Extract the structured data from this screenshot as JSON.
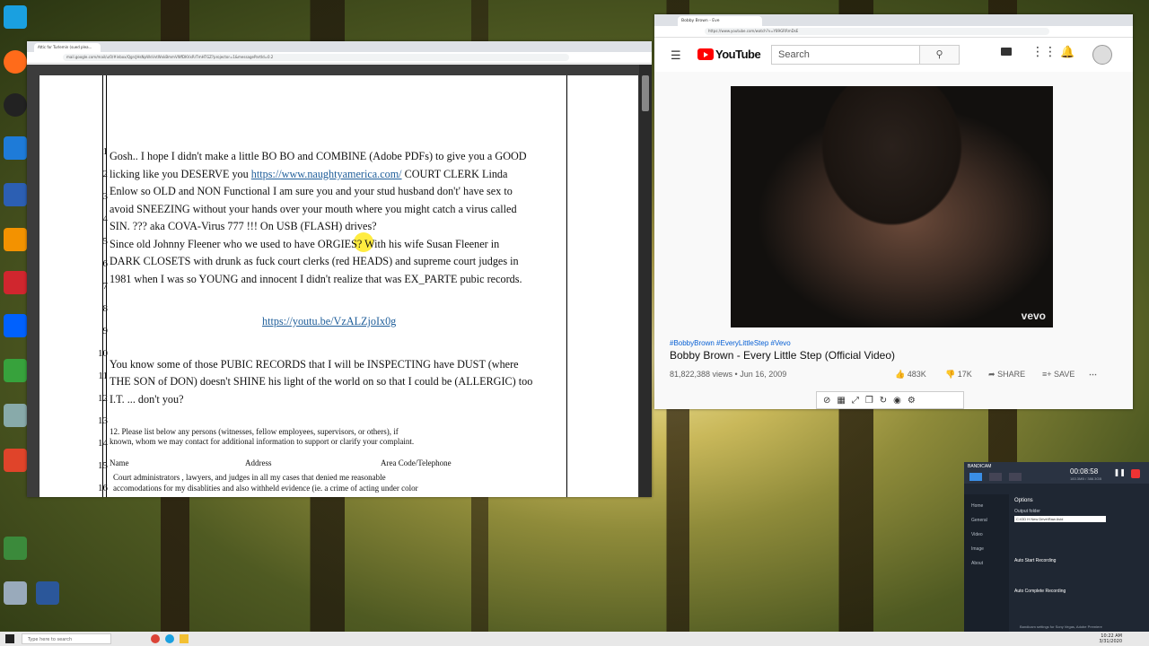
{
  "desktop": {
    "icons": [
      "Microsoft Edge",
      "Avast Cleanup",
      "Acrobat Reader DC",
      "VLC media player",
      "Quicken",
      "Dropbox",
      "Camtasia 2019",
      "WBB Pro",
      "Bandicam",
      "Camtasia Recording",
      "Recycle Bin",
      "Word"
    ]
  },
  "gmail": {
    "tab_title": "Attic for Turlemin (sued plea...",
    "url": "mail.google.com/mail/u/0/#inbox/QgrcJHsNpWsVvtWxkBmmVWfDKVxRrTmHTGZ?projector=1&messagePartId=0.2",
    "line_numbers": [
      "1",
      "2",
      "3",
      "4",
      "5",
      "6",
      "7",
      "8",
      "9",
      "10",
      "11",
      "12",
      "13",
      "14",
      "15",
      "16"
    ],
    "lines": [
      "Gosh.. I hope I didn't make a little BO BO and COMBINE (Adobe PDFs) to give you a GOOD",
      "licking like you DESERVE you ",
      "https://www.naughtyamerica.com/",
      " COURT CLERK Linda",
      "Enlow so OLD and NON Functional I am sure you and your stud husband don't' have sex to",
      "avoid SNEEZING without your hands over your mouth where you might catch a virus called",
      "SIN. ??? aka COVA-Virus 777 !!!  On USB (FLASH) drives?",
      "Since old Johnny Fleener who we used to have ORGIES? With his wife Susan Fleener in",
      "DARK CLOSETS with drunk as fuck court clerks (red HEADS) and supreme court  judges in",
      "1981 when I was so YOUNG and innocent I didn't realize that was EX_PARTE pubic records.",
      "https://youtu.be/VzALZjoIx0g",
      "You know some of those PUBIC RECORDS that I will be INSPECTING have DUST (where",
      "THE SON of DON) doesn't SHINE his light of the world on so that I could be (ALLERGIC) too",
      "I.T. ... don't you?",
      "12. Please list below any persons (witnesses, fellow employees, supervisors, or others), if",
      "known, whom we may contact for additional information to support or clarify your complaint.",
      "Name",
      "Address",
      "Area Code/Telephone",
      "Court administrators , lawyers, and judges in all my cases that denied me reasonable",
      "accomodations for my disablities and also withheld evidence (ie. a crime of acting under color"
    ]
  },
  "youtube": {
    "tab_title": "Bobby Brown - Eve",
    "url": "https://www.youtube.com/watch?v=Y89GRRmDsE",
    "logo_text": "YouTube",
    "search_placeholder": "Search",
    "watermark": "vevo",
    "hashtags": "#BobbyBrown #EveryLittleStep #Vevo",
    "title": "Bobby Brown - Every Little Step (Official Video)",
    "views": "81,822,388 views • Jun 16, 2009",
    "likes": "483K",
    "dislikes": "17K",
    "share": "SHARE",
    "save": "SAVE"
  },
  "bandicam": {
    "time": "00:08:58",
    "size": "183.3MB / 388.3GB",
    "menu": [
      "Home",
      "General",
      "Video",
      "Image",
      "About"
    ],
    "section_options": "Options",
    "output_folder_label": "Output folder",
    "output_folder_value": "C:\\OD H New Drive\\Raw Avid",
    "auto_start": "Auto Start Recording",
    "auto_complete": "Auto Complete Recording",
    "footer": "Bandicam settings for Sony Vegas, Adobe Premiere"
  },
  "taskbar": {
    "search_placeholder": "Type here to search",
    "clock_time": "10:22 AM",
    "clock_date": "3/31/2020"
  }
}
